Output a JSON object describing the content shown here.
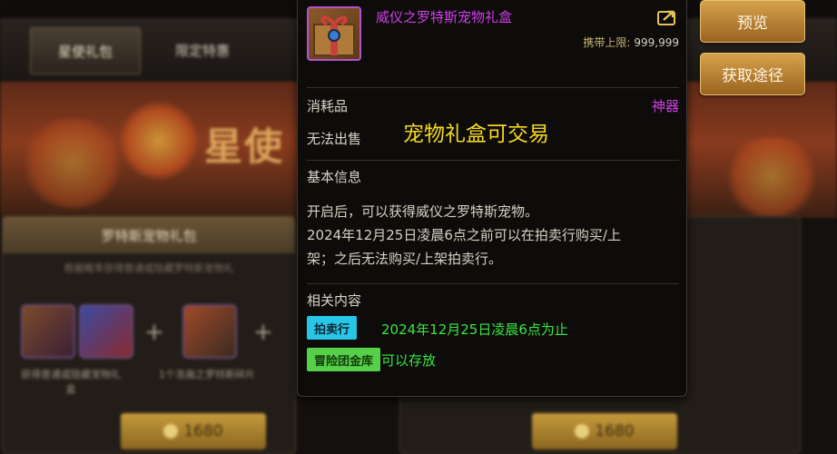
{
  "background": {
    "tabs": [
      "星使礼包",
      "限定特惠"
    ],
    "banner_text": "星使",
    "card_title": "罗特斯宠物礼包",
    "card_sub": "根据概率获得普通或隐藏罗特斯宠物礼",
    "slot_caption_1": "获得普通或隐藏宠物礼盒",
    "slot_caption_2": "1个浩瀚之罗特斯碎片",
    "price_left": "1680",
    "price_right": "1680"
  },
  "tooltip": {
    "item_name": "威仪之罗特斯宠物礼盒",
    "limit_label": "携带上限:",
    "limit_value": "999,999",
    "type_label": "消耗品",
    "category": "神器",
    "sell_status": "无法出售",
    "overlay_note": "宠物礼盒可交易",
    "basic_info_title": "基本信息",
    "description_lines": [
      "开启后，可以获得威仪之罗特斯宠物。",
      "2024年12月25日凌晨6点之前可以在拍卖行购买/上",
      "架；之后无法购买/上架拍卖行。"
    ],
    "related_title": "相关内容",
    "auction_tag": "拍卖行",
    "auction_text": "2024年12月25日凌晨6点为止",
    "vault_tag": "冒险团金库",
    "vault_text": "可以存放"
  },
  "buttons": {
    "preview": "预览",
    "obtain": "获取途径"
  },
  "colors": {
    "item_name": "#d13fe6",
    "note": "#f5d81d",
    "auction_tag": "#27c6e6",
    "vault_tag": "#56d048",
    "green_text": "#39e63d"
  },
  "icons": [
    "share-icon",
    "coin-icon",
    "gift-box-icon"
  ]
}
